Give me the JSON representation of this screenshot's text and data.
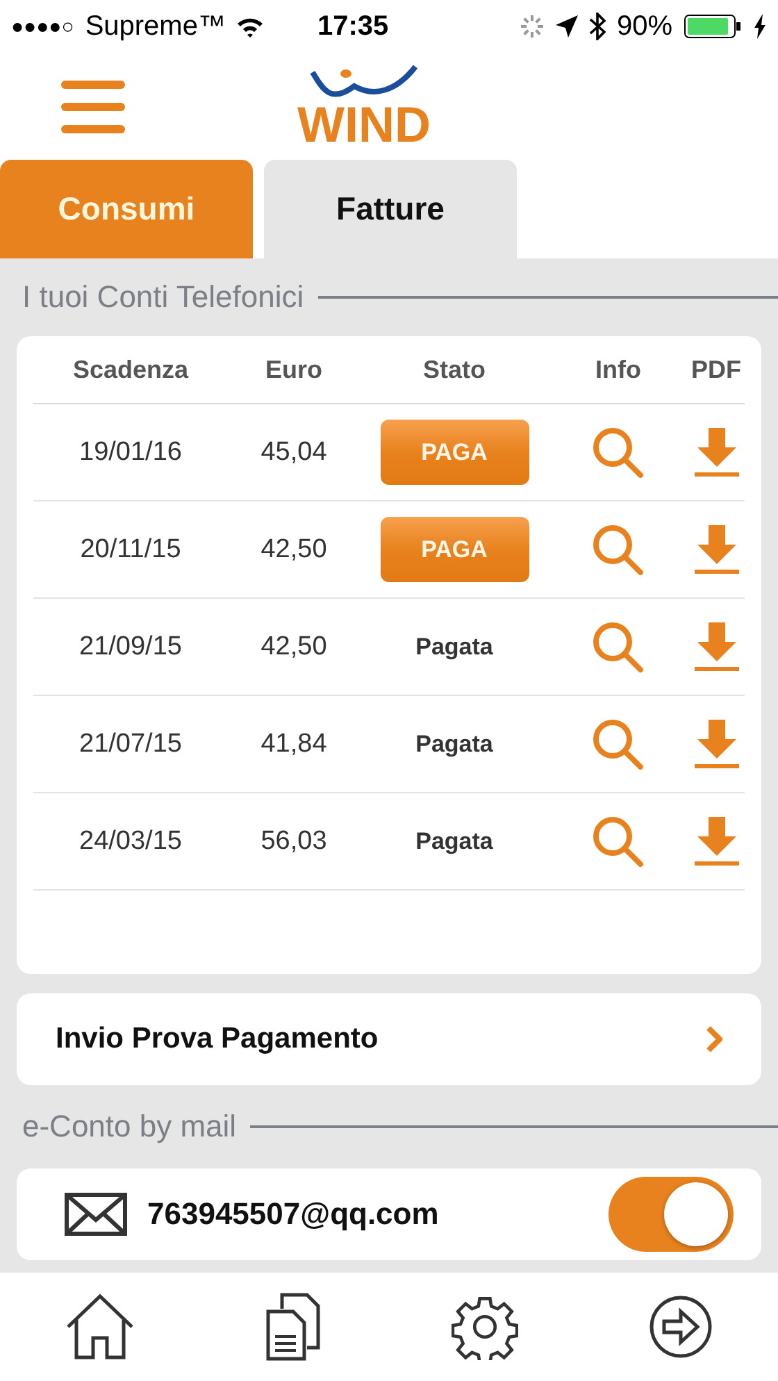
{
  "status_bar": {
    "carrier": "Supreme™",
    "signal_dots": "●●●●○",
    "time": "17:35",
    "battery": "90%"
  },
  "header": {
    "logo": "WIND"
  },
  "tabs": [
    {
      "label": "Consumi",
      "selected": true
    },
    {
      "label": "Fatture",
      "selected": false
    }
  ],
  "bills_section": {
    "title": "I tuoi Conti Telefonici"
  },
  "table": {
    "columns": [
      "Scadenza",
      "Euro",
      "Stato",
      "Info",
      "PDF"
    ],
    "rows": [
      {
        "date": "19/01/16",
        "amount": "45,04",
        "status": {
          "kind": "button",
          "label": "PAGA"
        }
      },
      {
        "date": "20/11/15",
        "amount": "42,50",
        "status": {
          "kind": "button",
          "label": "PAGA"
        }
      },
      {
        "date": "21/09/15",
        "amount": "42,50",
        "status": {
          "kind": "text",
          "label": "Pagata"
        }
      },
      {
        "date": "21/07/15",
        "amount": "41,84",
        "status": {
          "kind": "text",
          "label": "Pagata"
        }
      },
      {
        "date": "24/03/15",
        "amount": "56,03",
        "status": {
          "kind": "text",
          "label": "Pagata"
        }
      }
    ]
  },
  "payment_proof": {
    "label": "Invio Prova Pagamento"
  },
  "email_section": {
    "title": "e-Conto by mail",
    "email": "763945507@qq.com",
    "on": true
  }
}
